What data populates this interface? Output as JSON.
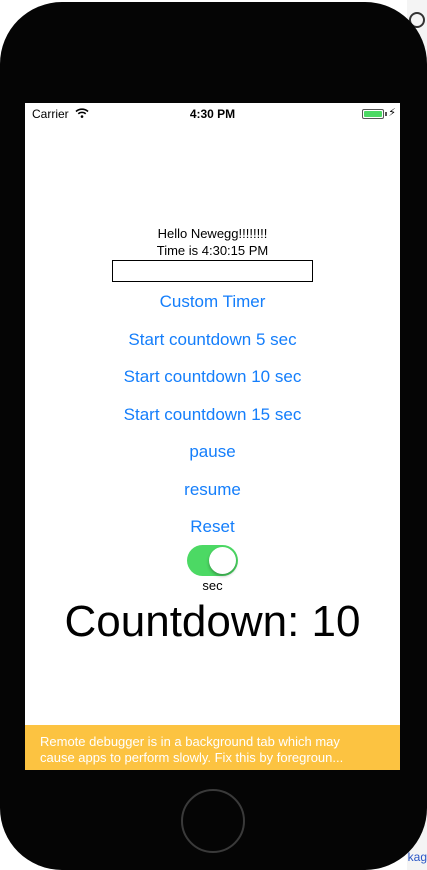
{
  "status_bar": {
    "carrier": "Carrier",
    "time": "4:30 PM",
    "wifi_icon": "wifi-icon",
    "battery_icon": "battery-icon",
    "charging_icon": "bolt-icon",
    "battery_color": "#4cd964"
  },
  "main": {
    "greeting": "Hello Newegg!!!!!!!!",
    "time_label": "Time is 4:30:15 PM",
    "input": {
      "value": "",
      "placeholder": ""
    },
    "buttons": {
      "custom_timer": "Custom Timer",
      "start_5": "Start countdown 5 sec",
      "start_10": "Start countdown 10 sec",
      "start_15": "Start countdown 15 sec",
      "pause": "pause",
      "resume": "resume",
      "reset": "Reset"
    },
    "switch": {
      "on": true,
      "color": "#4cd964"
    },
    "switch_label": "sec",
    "countdown": "Countdown: 10"
  },
  "banner": {
    "line1": "Remote debugger is in a background tab which may",
    "line2": "cause apps to perform slowly. Fix this by foregroun...",
    "color": "#fcc341"
  },
  "colors": {
    "accent": "#147efb",
    "device": "#050505"
  }
}
